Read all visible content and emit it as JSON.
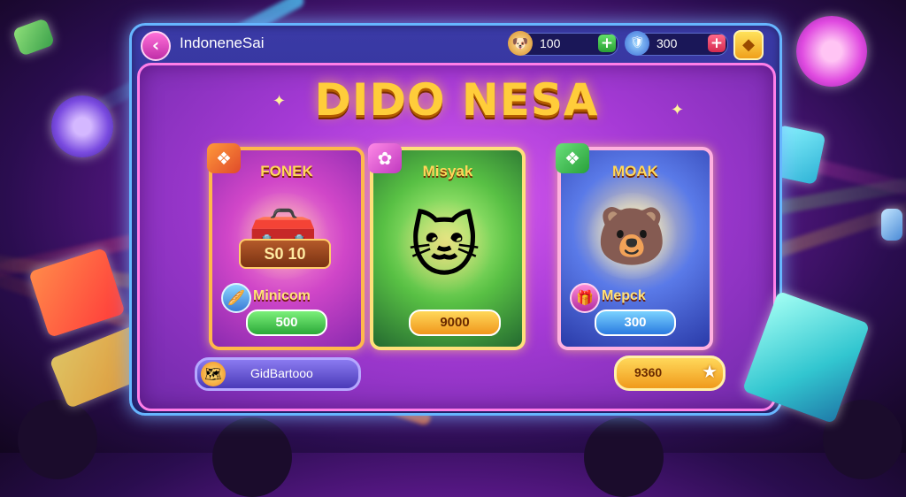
{
  "header": {
    "title": "IndonenеSai",
    "back_icon": "‹",
    "star_icon": "◆"
  },
  "currencies": [
    {
      "icon": "🐶",
      "value": "100",
      "plus": "+"
    },
    {
      "icon": "🛡",
      "value": "300",
      "plus": "+"
    }
  ],
  "headline": "DIDO NESA",
  "cards": [
    {
      "name": "FONEK",
      "badge_icon": "❖",
      "art_icon": "🧰",
      "art_label": "S0 10",
      "sub_icon": "🥖",
      "sub_label": "Minicom",
      "price": "500"
    },
    {
      "name": "Misyak",
      "badge_icon": "✿",
      "art_icon": "🐱",
      "price": "9000"
    },
    {
      "name": "MOAK",
      "badge_icon": "❖",
      "art_icon": "🐻",
      "sub_icon": "🎁",
      "sub_label": "Mepck",
      "price": "300"
    }
  ],
  "footer": {
    "left_icon": "🗺",
    "left_label": "GidBartooo",
    "right_label": "9360",
    "right_icon": "★"
  }
}
